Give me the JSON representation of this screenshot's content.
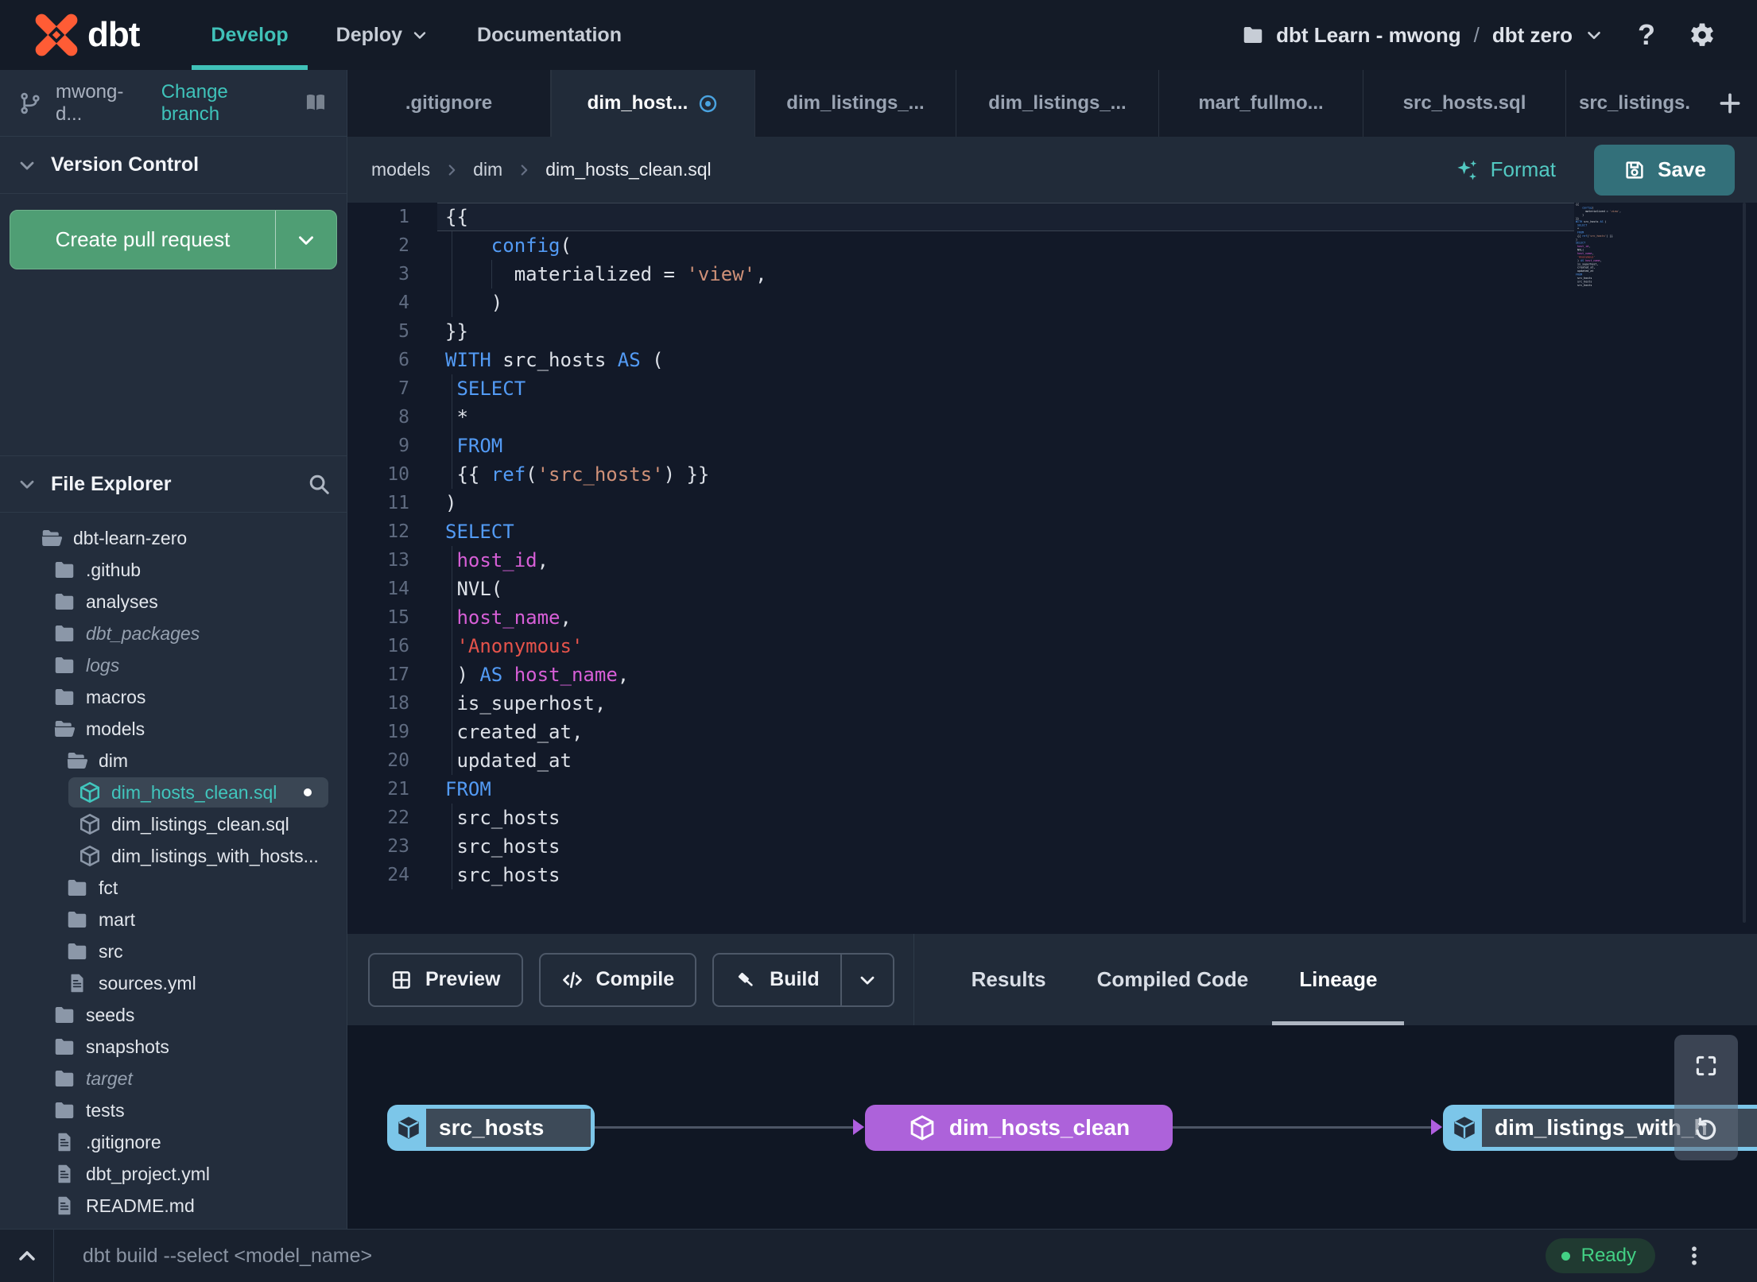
{
  "navbar": {
    "brand": "dbt",
    "items": [
      {
        "label": "Develop",
        "active": true,
        "chevron": false
      },
      {
        "label": "Deploy",
        "active": false,
        "chevron": true
      },
      {
        "label": "Documentation",
        "active": false,
        "chevron": false
      }
    ],
    "project": {
      "account": "dbt Learn - mwong",
      "separator": "/",
      "name": "dbt zero"
    },
    "help_label": "?"
  },
  "sidebar": {
    "branch": {
      "name": "mwong-d...",
      "change_link": "Change branch"
    },
    "version_control": {
      "title": "Version Control",
      "button_label": "Create pull request"
    },
    "file_explorer": {
      "title": "File Explorer",
      "tree": [
        {
          "label": "dbt-learn-zero",
          "icon": "folder-open-icon",
          "level": 0
        },
        {
          "label": ".github",
          "icon": "folder-icon",
          "level": 1
        },
        {
          "label": "analyses",
          "icon": "folder-icon",
          "level": 1
        },
        {
          "label": "dbt_packages",
          "icon": "folder-icon",
          "level": 1,
          "italic": true
        },
        {
          "label": "logs",
          "icon": "folder-icon",
          "level": 1,
          "italic": true
        },
        {
          "label": "macros",
          "icon": "folder-icon",
          "level": 1
        },
        {
          "label": "models",
          "icon": "folder-open-icon",
          "level": 1
        },
        {
          "label": "dim",
          "icon": "folder-open-icon",
          "level": 2
        },
        {
          "label": "dim_hosts_clean.sql",
          "icon": "model-icon",
          "level": 3,
          "selected": true,
          "modified": true
        },
        {
          "label": "dim_listings_clean.sql",
          "icon": "model-icon",
          "level": 3
        },
        {
          "label": "dim_listings_with_hosts...",
          "icon": "model-icon",
          "level": 3
        },
        {
          "label": "fct",
          "icon": "folder-icon",
          "level": 2
        },
        {
          "label": "mart",
          "icon": "folder-icon",
          "level": 2
        },
        {
          "label": "src",
          "icon": "folder-icon",
          "level": 2
        },
        {
          "label": "sources.yml",
          "icon": "file-icon",
          "level": 2
        },
        {
          "label": "seeds",
          "icon": "folder-icon",
          "level": 1
        },
        {
          "label": "snapshots",
          "icon": "folder-icon",
          "level": 1
        },
        {
          "label": "target",
          "icon": "folder-icon",
          "level": 1,
          "italic": true
        },
        {
          "label": "tests",
          "icon": "folder-icon",
          "level": 1
        },
        {
          "label": ".gitignore",
          "icon": "file-icon",
          "level": 1
        },
        {
          "label": "dbt_project.yml",
          "icon": "file-icon",
          "level": 1
        },
        {
          "label": "README.md",
          "icon": "file-icon",
          "level": 1
        }
      ]
    }
  },
  "editor": {
    "tabs": [
      {
        "label": ".gitignore",
        "active": false
      },
      {
        "label": "dim_host...",
        "active": true,
        "modified": true
      },
      {
        "label": "dim_listings_...",
        "active": false
      },
      {
        "label": "dim_listings_...",
        "active": false
      },
      {
        "label": "mart_fullmo...",
        "active": false
      },
      {
        "label": "src_hosts.sql",
        "active": false
      },
      {
        "label": "src_listings.",
        "active": false
      }
    ],
    "breadcrumb": [
      "models",
      "dim",
      "dim_hosts_clean.sql"
    ],
    "actions": {
      "format_label": "Format",
      "save_label": "Save"
    },
    "code_lines": [
      {
        "n": 1,
        "current": true,
        "segs": [
          [
            "{{",
            "p"
          ]
        ]
      },
      {
        "n": 2,
        "segs": [
          [
            "    ",
            "p"
          ],
          [
            "config",
            "kw"
          ],
          [
            "(",
            "p"
          ]
        ]
      },
      {
        "n": 3,
        "segs": [
          [
            "      materialized = ",
            "p"
          ],
          [
            "'view'",
            "str"
          ],
          [
            ",",
            "p"
          ]
        ]
      },
      {
        "n": 4,
        "segs": [
          [
            "    )",
            "p"
          ]
        ]
      },
      {
        "n": 5,
        "segs": [
          [
            "}}",
            "p"
          ]
        ]
      },
      {
        "n": 6,
        "segs": [
          [
            "WITH",
            "kw"
          ],
          [
            " src_hosts ",
            "p"
          ],
          [
            "AS",
            "kw"
          ],
          [
            " (",
            "p"
          ]
        ]
      },
      {
        "n": 7,
        "segs": [
          [
            " ",
            "p"
          ],
          [
            "SELECT",
            "kw"
          ]
        ]
      },
      {
        "n": 8,
        "segs": [
          [
            " *",
            "p"
          ]
        ]
      },
      {
        "n": 9,
        "segs": [
          [
            " ",
            "p"
          ],
          [
            "FROM",
            "kw"
          ]
        ]
      },
      {
        "n": 10,
        "segs": [
          [
            " {{ ",
            "p"
          ],
          [
            "ref",
            "kw"
          ],
          [
            "(",
            "p"
          ],
          [
            "'src_hosts'",
            "str"
          ],
          [
            ") }}",
            "p"
          ]
        ]
      },
      {
        "n": 11,
        "segs": [
          [
            ")",
            "p"
          ]
        ]
      },
      {
        "n": 12,
        "segs": [
          [
            "SELECT",
            "kw"
          ]
        ]
      },
      {
        "n": 13,
        "segs": [
          [
            " ",
            "p"
          ],
          [
            "host_id",
            "id"
          ],
          [
            ",",
            "p"
          ]
        ]
      },
      {
        "n": 14,
        "segs": [
          [
            " NVL(",
            "p"
          ]
        ]
      },
      {
        "n": 15,
        "segs": [
          [
            " ",
            "p"
          ],
          [
            "host_name",
            "id"
          ],
          [
            ",",
            "p"
          ]
        ]
      },
      {
        "n": 16,
        "segs": [
          [
            " ",
            "p"
          ],
          [
            "'Anonymous'",
            "str2"
          ]
        ]
      },
      {
        "n": 17,
        "segs": [
          [
            " ) ",
            "p"
          ],
          [
            "AS",
            "kw"
          ],
          [
            " ",
            "p"
          ],
          [
            "host_name",
            "id"
          ],
          [
            ",",
            "p"
          ]
        ]
      },
      {
        "n": 18,
        "segs": [
          [
            " is_superhost,",
            "p"
          ]
        ]
      },
      {
        "n": 19,
        "segs": [
          [
            " created_at,",
            "p"
          ]
        ]
      },
      {
        "n": 20,
        "segs": [
          [
            " updated_at",
            "p"
          ]
        ]
      },
      {
        "n": 21,
        "segs": [
          [
            "FROM",
            "kw"
          ]
        ]
      },
      {
        "n": 22,
        "segs": [
          [
            " src_hosts",
            "p"
          ]
        ]
      },
      {
        "n": 23,
        "segs": [
          [
            " src_hosts",
            "p"
          ]
        ]
      },
      {
        "n": 24,
        "segs": [
          [
            " src_hosts",
            "p"
          ]
        ]
      }
    ]
  },
  "bottom_panel": {
    "buttons": [
      {
        "label": "Preview",
        "icon": "grid-icon",
        "split": false
      },
      {
        "label": "Compile",
        "icon": "code-icon",
        "split": false
      },
      {
        "label": "Build",
        "icon": "hammer-icon",
        "split": true
      }
    ],
    "tabs": [
      {
        "label": "Results",
        "active": false
      },
      {
        "label": "Compiled Code",
        "active": false
      },
      {
        "label": "Lineage",
        "active": true
      }
    ],
    "lineage": {
      "nodes": [
        {
          "label": "src_hosts",
          "kind": "source"
        },
        {
          "label": "dim_hosts_clean",
          "kind": "model"
        },
        {
          "label": "dim_listings_with_h",
          "kind": "source"
        }
      ]
    }
  },
  "statusbar": {
    "command": "dbt build --select <model_name>",
    "status": "Ready"
  },
  "colors": {
    "accent_teal": "#40c1b8",
    "button_green": "#4f9e74",
    "save_teal": "#33707a",
    "node_blue": "#7cc6e9",
    "node_purple": "#ad62da",
    "ready_green": "#43d185",
    "keyword_blue": "#539bf5",
    "string_tan": "#cf9178",
    "string_red": "#e5534b",
    "identifier_magenta": "#d75fd7"
  }
}
